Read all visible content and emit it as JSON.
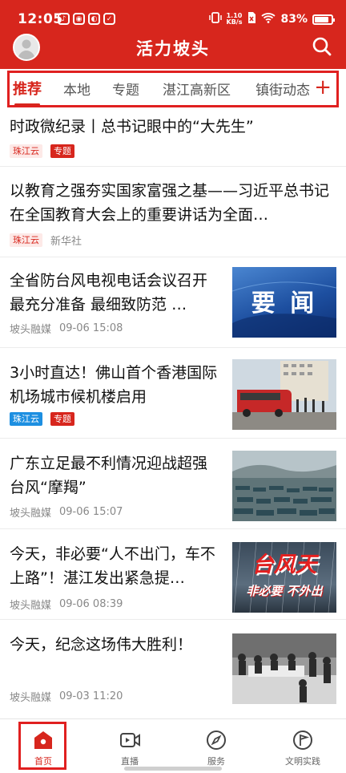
{
  "status_bar": {
    "time": "12:05",
    "left_icons": [
      "tiktok-icon",
      "app-icon",
      "app-icon",
      "check-icon"
    ],
    "right_icons": [
      "vibrate-icon",
      "data-speed-icon",
      "sim-off-icon",
      "wifi-icon",
      "battery-icon"
    ],
    "net_speed_value": "1.10",
    "net_speed_unit": "KB/s",
    "battery_percent": "83%",
    "battery_level": 0.83
  },
  "header": {
    "title": "活力坡头",
    "bg_color": "#d7261d"
  },
  "tabs": {
    "items": [
      "推荐",
      "本地",
      "专题",
      "湛江高新区",
      "镇街动态"
    ],
    "active_index": 0,
    "add_label": "+"
  },
  "feed": [
    {
      "title": "时政微纪录丨总书记眼中的“大先生”",
      "tags": [
        {
          "text": "珠江云",
          "style": "light"
        },
        {
          "text": "专题",
          "style": "red"
        }
      ],
      "source": "",
      "time": "",
      "thumbnail": ""
    },
    {
      "title": "以教育之强夯实国家富强之基——习近平总书记在全国教育大会上的重要讲话为全面…",
      "tags": [
        {
          "text": "珠江云",
          "style": "light"
        }
      ],
      "source": "新华社",
      "time": "",
      "thumbnail": ""
    },
    {
      "title": "全省防台风电视电话会议召开 最充分准备 最细致防范 …",
      "tags": [],
      "source": "坡头融媒",
      "time": "09-06 15:08",
      "thumbnail": "news-graphic",
      "thumbnail_text": "要 闻"
    },
    {
      "title": "3小时直达！佛山首个香港国际机场城市候机楼启用",
      "tags": [
        {
          "text": "珠江云",
          "style": "blue"
        },
        {
          "text": "专题",
          "style": "red"
        }
      ],
      "source": "",
      "time": "",
      "thumbnail": "bus-photo"
    },
    {
      "title": "广东立足最不利情况迎战超强台风“摩羯”",
      "tags": [],
      "source": "坡头融媒",
      "time": "09-06 15:07",
      "thumbnail": "harbor-photo"
    },
    {
      "title": "今天，非必要“人不出门，车不上路”！湛江发出紧急提…",
      "tags": [],
      "source": "坡头融媒",
      "time": "09-06 08:39",
      "thumbnail": "typhoon-graphic",
      "thumbnail_text_1": "台风天",
      "thumbnail_text_2": "非必要 不外出"
    },
    {
      "title": "今天，纪念这场伟大胜利！",
      "tags": [],
      "source": "坡头融媒",
      "time": "09-03 11:20",
      "thumbnail": "historic-photo"
    }
  ],
  "bottom_nav": {
    "items": [
      {
        "label": "首页",
        "icon": "home-icon",
        "active": true
      },
      {
        "label": "直播",
        "icon": "live-icon",
        "active": false
      },
      {
        "label": "服务",
        "icon": "compass-icon",
        "active": false
      },
      {
        "label": "文明实践",
        "icon": "flag-icon",
        "active": false
      }
    ]
  },
  "colors": {
    "brand_red": "#d7261d",
    "tag_blue": "#1d8fe1",
    "highlight_box": "#e02020"
  }
}
